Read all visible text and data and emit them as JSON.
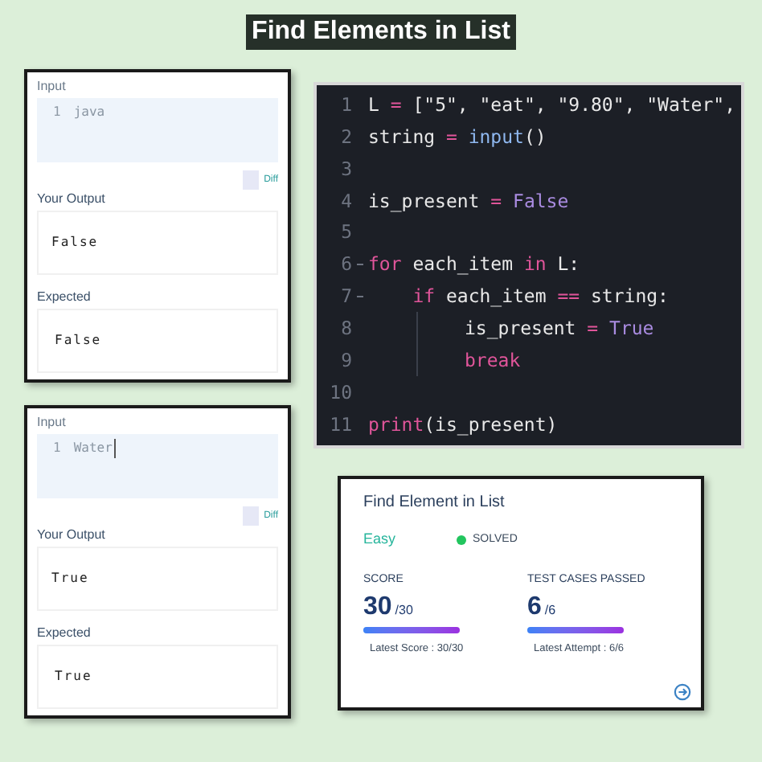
{
  "title": "Find Elements in List",
  "test_results": [
    {
      "input_label": "Input",
      "input_lines": [
        {
          "number": "1",
          "text": "java",
          "cursor": false
        }
      ],
      "diff": {
        "label": "Diff",
        "checked": false
      },
      "output_label": "Your Output",
      "output": "False",
      "expected_label": "Expected",
      "expected": "False"
    },
    {
      "input_label": "Input",
      "input_lines": [
        {
          "number": "1",
          "text": "Water",
          "cursor": true
        }
      ],
      "diff": {
        "label": "Diff",
        "checked": false
      },
      "output_label": "Your Output",
      "output": "True",
      "expected_label": "Expected",
      "expected": "True"
    }
  ],
  "editor": {
    "lines": [
      {
        "number": "1",
        "fold": false,
        "guide": false,
        "tokens": [
          {
            "text": "L ",
            "kind": "plain"
          },
          {
            "text": "=",
            "kind": "op"
          },
          {
            "text": " [\"5\", \"eat\", \"9.80\", \"Water\",",
            "kind": "plain"
          }
        ]
      },
      {
        "number": "2",
        "fold": false,
        "guide": false,
        "tokens": [
          {
            "text": "string ",
            "kind": "plain"
          },
          {
            "text": "= ",
            "kind": "op"
          },
          {
            "text": "input",
            "kind": "builtin"
          },
          {
            "text": "()",
            "kind": "plain"
          }
        ]
      },
      {
        "number": "3",
        "fold": false,
        "guide": false
      },
      {
        "number": "4",
        "fold": false,
        "guide": false,
        "tokens": [
          {
            "text": "is_present ",
            "kind": "plain"
          },
          {
            "text": "= ",
            "kind": "op"
          },
          {
            "text": "False",
            "kind": "const"
          }
        ]
      },
      {
        "number": "5",
        "fold": false,
        "guide": false
      },
      {
        "number": "6",
        "fold": true,
        "guide": false,
        "tokens": [
          {
            "text": "for",
            "kind": "keyword"
          },
          {
            "text": " each_item ",
            "kind": "plain"
          },
          {
            "text": "in",
            "kind": "keyword"
          },
          {
            "text": " L:",
            "kind": "plain"
          }
        ]
      },
      {
        "number": "7",
        "fold": true,
        "guide": false,
        "tokens": [
          {
            "text": "    if",
            "kind": "keyword"
          },
          {
            "text": " each_item ",
            "kind": "plain"
          },
          {
            "text": "==",
            "kind": "op"
          },
          {
            "text": " string:",
            "kind": "plain"
          }
        ]
      },
      {
        "number": "8",
        "fold": false,
        "guide": true,
        "tokens": [
          {
            "text": "is_present ",
            "kind": "plain"
          },
          {
            "text": "= ",
            "kind": "op"
          },
          {
            "text": "True",
            "kind": "const"
          }
        ]
      },
      {
        "number": "9",
        "fold": false,
        "guide": true,
        "tokens": [
          {
            "text": "break",
            "kind": "keyword"
          }
        ]
      },
      {
        "number": "10",
        "fold": false,
        "guide": false
      },
      {
        "number": "11",
        "fold": false,
        "guide": false,
        "tokens": [
          {
            "text": "print",
            "kind": "keyword"
          },
          {
            "text": "(is_present)",
            "kind": "plain"
          }
        ]
      }
    ]
  },
  "result_card": {
    "title": "Find Element in List",
    "difficulty": "Easy",
    "status": {
      "label": "SOLVED",
      "color": "#22c55e"
    },
    "stats": [
      {
        "label": "SCORE",
        "value": "30",
        "total": "/30",
        "level": 1,
        "latest": "Latest Score : 30/30"
      },
      {
        "label": "TEST CASES PASSED",
        "value": "6",
        "total": "/6",
        "level": 1,
        "latest": "Latest Attempt : 6/6"
      }
    ]
  }
}
